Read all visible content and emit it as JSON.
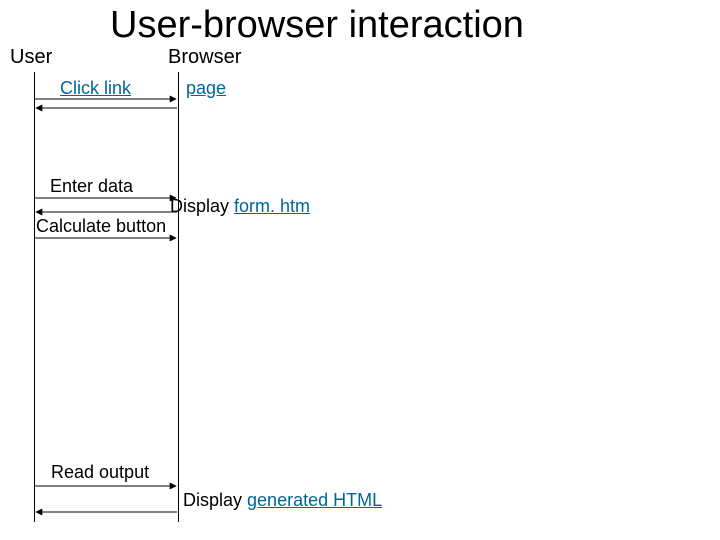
{
  "title": "User-browser interaction",
  "actors": {
    "user": "User",
    "browser": "Browser"
  },
  "messages": {
    "click_link": "Click link",
    "page": "page",
    "enter_data": "Enter data",
    "display_form_prefix": "Display ",
    "display_form_link": "form. htm",
    "calculate_button": "Calculate button",
    "read_output": "Read output",
    "display_html_prefix": "Display ",
    "display_html_link": "generated HTML"
  }
}
